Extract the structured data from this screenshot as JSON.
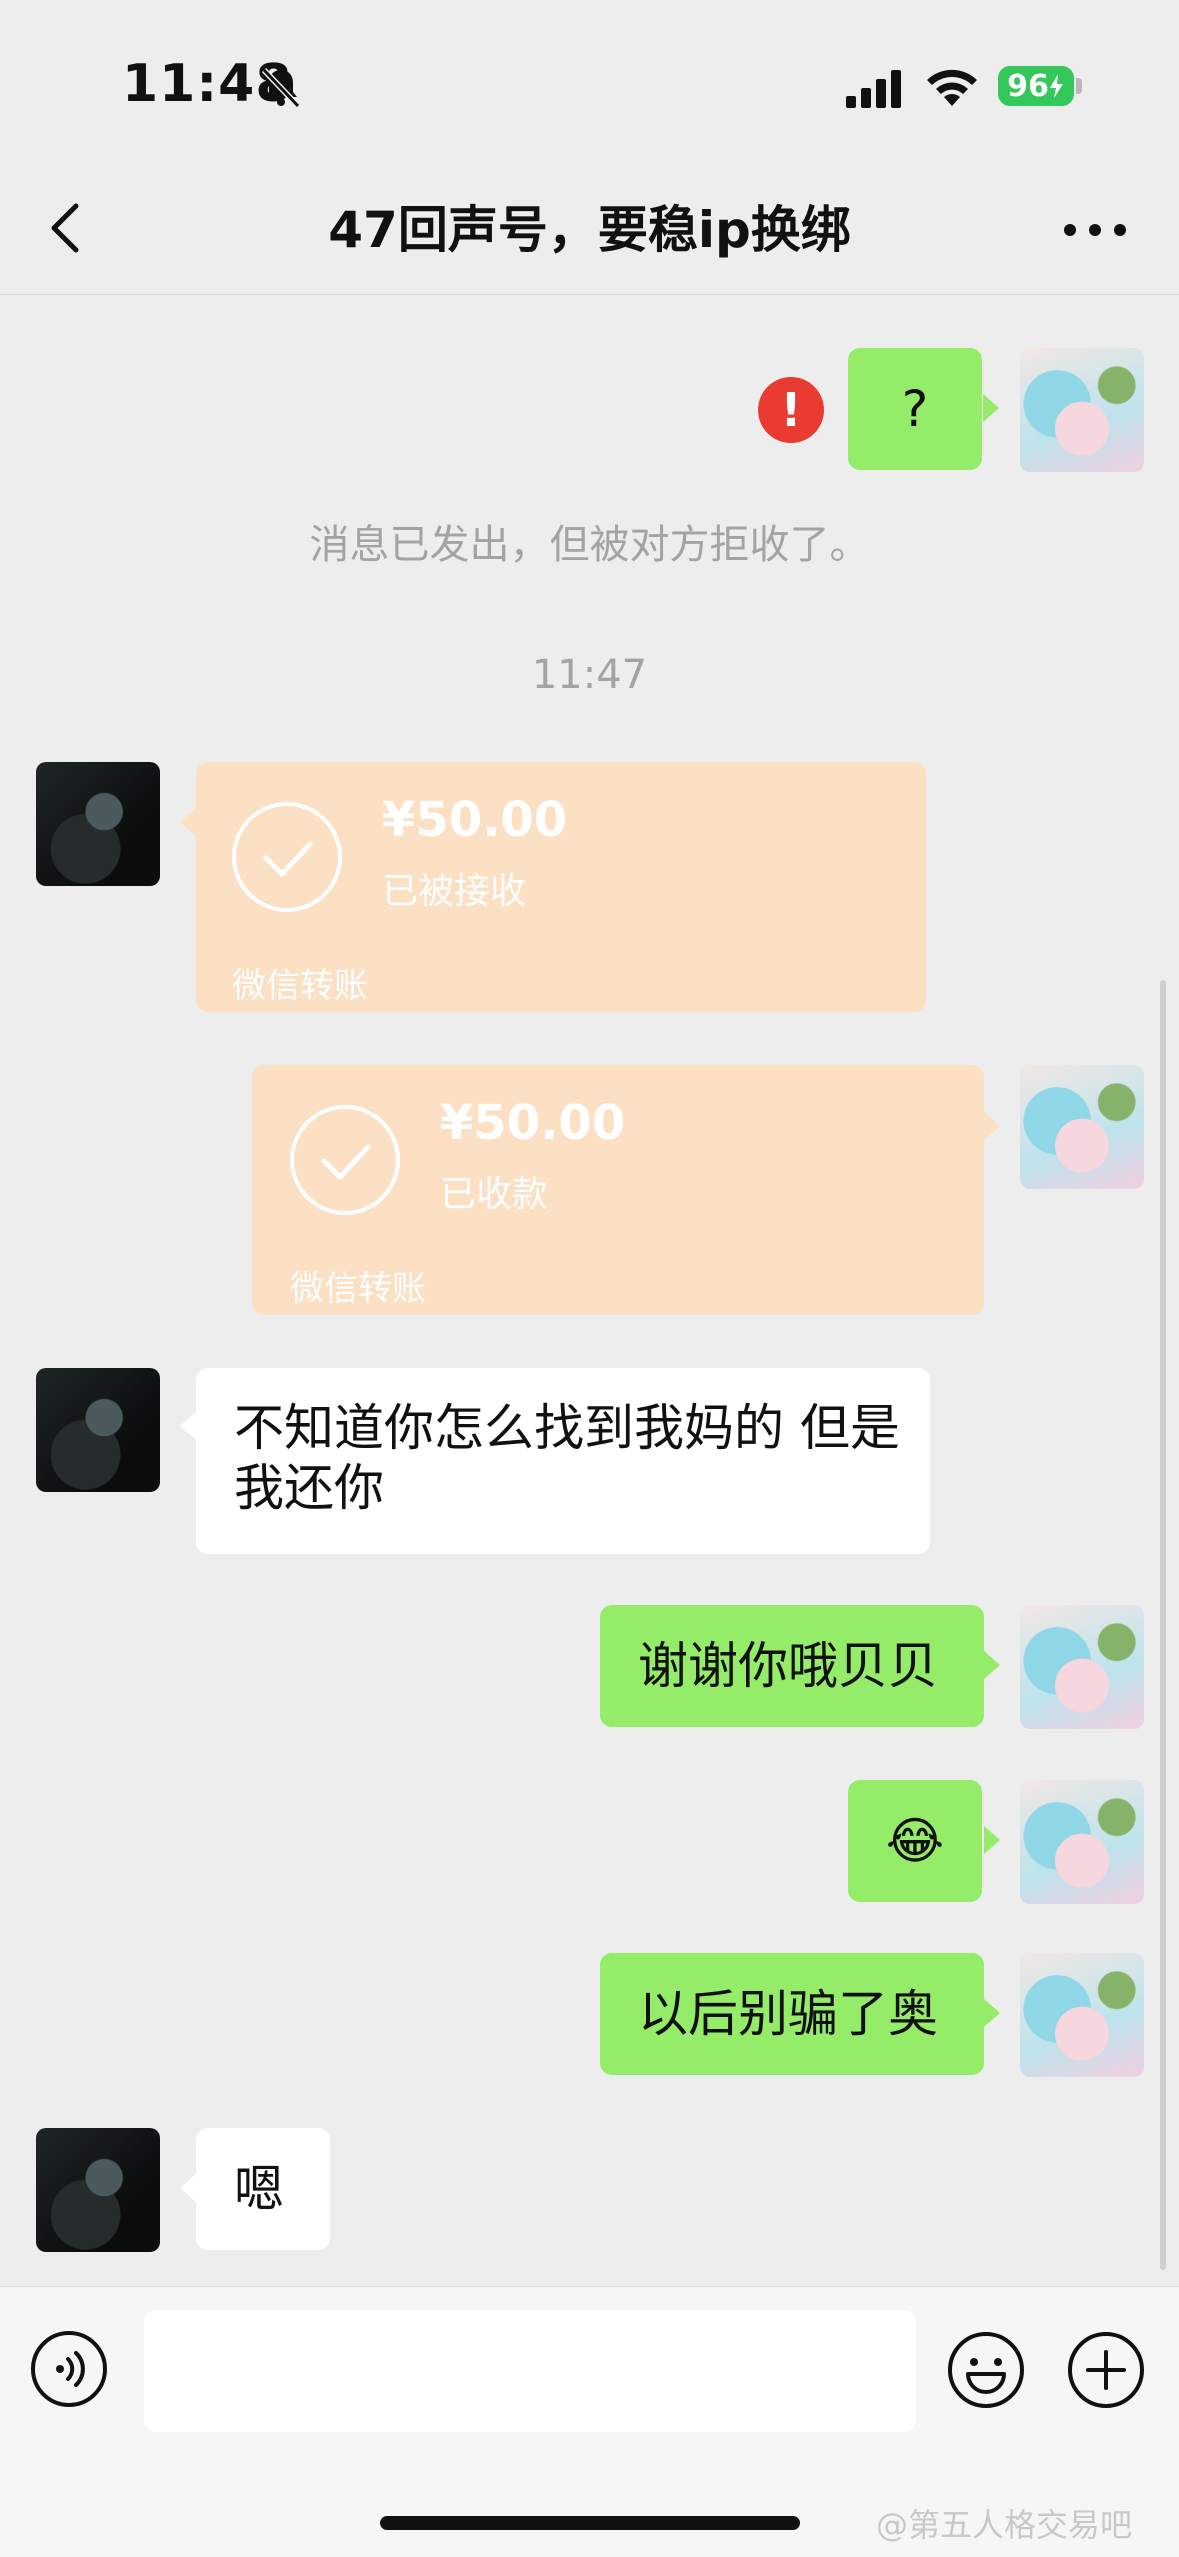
{
  "status_bar": {
    "time": "11:48",
    "battery": "96",
    "icons": [
      "bell-slash-icon",
      "signal-icon",
      "wifi-icon",
      "battery-charging-icon"
    ]
  },
  "nav": {
    "title": "47回声号，要稳ip换绑",
    "icons": [
      "back-chevron-icon",
      "more-dots-icon"
    ]
  },
  "messages": {
    "m1_text": "?",
    "m1_error_mark": "!",
    "notice": "消息已发出，但被对方拒收了。",
    "timestamp": "11:47",
    "transfer1": {
      "amount": "¥50.00",
      "status": "已被接收",
      "label": "微信转账"
    },
    "transfer2": {
      "amount": "¥50.00",
      "status": "已收款",
      "label": "微信转账"
    },
    "m4_text": "不知道你怎么找到我妈的 但是我还你",
    "m5_text": "谢谢你哦贝贝",
    "m6_emoji": "😂",
    "m7_text": "以后别骗了奥",
    "m8_text": "嗯"
  },
  "input_bar": {
    "value": "",
    "icons": [
      "voice-icon",
      "emoji-icon",
      "plus-icon"
    ]
  },
  "watermark": "@第五人格交易吧",
  "colors": {
    "background": "#ededed",
    "sent_bubble": "#95ec69",
    "received_bubble": "#ffffff",
    "transfer_card": "#fbe0c4",
    "error": "#e93b31",
    "battery": "#34c759"
  }
}
